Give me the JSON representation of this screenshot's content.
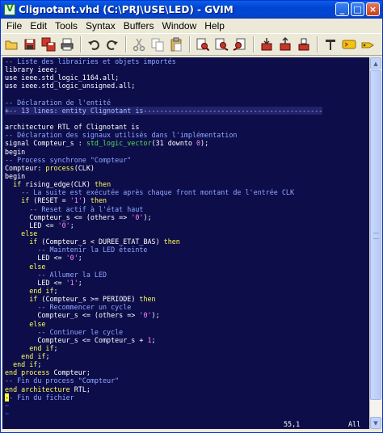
{
  "window": {
    "title": "Clignotant.vhd (C:\\PRJ\\USE\\LED) - GVIM",
    "minimize_glyph": "_",
    "maximize_glyph": "□",
    "close_glyph": "×"
  },
  "menu": [
    "File",
    "Edit",
    "Tools",
    "Syntax",
    "Buffers",
    "Window",
    "Help"
  ],
  "toolbar": [
    {
      "icon": "open-icon"
    },
    {
      "icon": "save-icon"
    },
    {
      "icon": "save-all-icon"
    },
    {
      "icon": "print-icon"
    },
    {
      "sep": true
    },
    {
      "icon": "undo-icon"
    },
    {
      "icon": "redo-icon"
    },
    {
      "sep": true
    },
    {
      "icon": "cut-icon"
    },
    {
      "icon": "copy-icon"
    },
    {
      "icon": "paste-icon"
    },
    {
      "sep": true
    },
    {
      "icon": "find-replace-icon"
    },
    {
      "icon": "find-next-icon"
    },
    {
      "icon": "find-prev-icon"
    },
    {
      "sep": true
    },
    {
      "icon": "load-session-icon"
    },
    {
      "icon": "save-session-icon"
    },
    {
      "icon": "run-script-icon"
    },
    {
      "sep": true
    },
    {
      "icon": "make-icon"
    },
    {
      "icon": "shell-icon"
    },
    {
      "icon": "tags-jump-icon"
    }
  ],
  "code_lines": [
    [
      [
        "-- Liste des librairies et objets importés",
        "comment"
      ]
    ],
    [
      [
        "library ieee;",
        "norm"
      ]
    ],
    [
      [
        "use ieee.std_logic_1164.all;",
        "norm"
      ]
    ],
    [
      [
        "use ieee.std_logic_unsigned.all;",
        "norm"
      ]
    ],
    [
      [
        "",
        "norm"
      ]
    ],
    [
      [
        "-- Déclaration de l'entité",
        "comment"
      ]
    ],
    [
      [
        "+-- 13 lines: entity Clignotant is--------------------------------------------",
        "fold"
      ]
    ],
    [
      [
        "",
        "norm"
      ]
    ],
    [
      [
        "architecture RTL of Clignotant is",
        "norm"
      ]
    ],
    [
      [
        "-- Déclaration des signaux utilisés dans l'implémentation",
        "comment"
      ]
    ],
    [
      [
        "signal Compteur_s : ",
        "norm"
      ],
      [
        "std_logic_vector",
        "type"
      ],
      [
        "(31 downto ",
        "norm"
      ],
      [
        "0",
        "str"
      ],
      [
        ");",
        "norm"
      ]
    ],
    [
      [
        "begin",
        "norm"
      ]
    ],
    [
      [
        "-- Process synchrone \"Compteur\"",
        "comment"
      ]
    ],
    [
      [
        "Compteur: ",
        "norm"
      ],
      [
        "process",
        "kw"
      ],
      [
        "(CLK)",
        "norm"
      ]
    ],
    [
      [
        "begin",
        "norm"
      ]
    ],
    [
      [
        "  ",
        "norm"
      ],
      [
        "if",
        "kw"
      ],
      [
        " rising_edge(CLK) ",
        "norm"
      ],
      [
        "then",
        "kw"
      ]
    ],
    [
      [
        "    -- La suite est exécutée après chaque front montant de l'entrée CLK",
        "comment"
      ]
    ],
    [
      [
        "    ",
        "norm"
      ],
      [
        "if",
        "kw"
      ],
      [
        " (RESET = ",
        "norm"
      ],
      [
        "'1'",
        "str"
      ],
      [
        ") ",
        "norm"
      ],
      [
        "then",
        "kw"
      ]
    ],
    [
      [
        "      -- Reset actif à l'état haut",
        "comment"
      ]
    ],
    [
      [
        "      Compteur_s <= (others => ",
        "norm"
      ],
      [
        "'0'",
        "str"
      ],
      [
        ");",
        "norm"
      ]
    ],
    [
      [
        "      LED <= ",
        "norm"
      ],
      [
        "'0'",
        "str"
      ],
      [
        ";",
        "norm"
      ]
    ],
    [
      [
        "    ",
        "norm"
      ],
      [
        "else",
        "kw"
      ]
    ],
    [
      [
        "      ",
        "norm"
      ],
      [
        "if",
        "kw"
      ],
      [
        " (Compteur_s < DUREE_ETAT_BAS) ",
        "norm"
      ],
      [
        "then",
        "kw"
      ]
    ],
    [
      [
        "        -- Maintenir la LED éteinte",
        "comment"
      ]
    ],
    [
      [
        "        LED <= ",
        "norm"
      ],
      [
        "'0'",
        "str"
      ],
      [
        ";",
        "norm"
      ]
    ],
    [
      [
        "      ",
        "norm"
      ],
      [
        "else",
        "kw"
      ]
    ],
    [
      [
        "        -- Allumer la LED",
        "comment"
      ]
    ],
    [
      [
        "        LED <= ",
        "norm"
      ],
      [
        "'1'",
        "str"
      ],
      [
        ";",
        "norm"
      ]
    ],
    [
      [
        "      ",
        "norm"
      ],
      [
        "end if",
        "kw"
      ],
      [
        ";",
        "norm"
      ]
    ],
    [
      [
        "      ",
        "norm"
      ],
      [
        "if",
        "kw"
      ],
      [
        " (Compteur_s >= PERIODE) ",
        "norm"
      ],
      [
        "then",
        "kw"
      ]
    ],
    [
      [
        "        -- Recommencer un cycle",
        "comment"
      ]
    ],
    [
      [
        "        Compteur_s <= (others => ",
        "norm"
      ],
      [
        "'0'",
        "str"
      ],
      [
        ");",
        "norm"
      ]
    ],
    [
      [
        "      ",
        "norm"
      ],
      [
        "else",
        "kw"
      ]
    ],
    [
      [
        "        -- Continuer le cycle",
        "comment"
      ]
    ],
    [
      [
        "        Compteur_s <= Compteur_s + ",
        "norm"
      ],
      [
        "1",
        "str"
      ],
      [
        ";",
        "norm"
      ]
    ],
    [
      [
        "      ",
        "norm"
      ],
      [
        "end if",
        "kw"
      ],
      [
        ";",
        "norm"
      ]
    ],
    [
      [
        "    ",
        "norm"
      ],
      [
        "end if",
        "kw"
      ],
      [
        ";",
        "norm"
      ]
    ],
    [
      [
        "  ",
        "norm"
      ],
      [
        "end if",
        "kw"
      ],
      [
        ";",
        "norm"
      ]
    ],
    [
      [
        "end process",
        "kw"
      ],
      [
        " Compteur;",
        "norm"
      ]
    ],
    [
      [
        "-- Fin du process \"Compteur\"",
        "comment"
      ]
    ],
    [
      [
        "end architecture",
        "kw"
      ],
      [
        " RTL;",
        "norm"
      ]
    ],
    [
      [
        "-",
        "cursor"
      ],
      [
        "- Fin du fichier",
        "comment"
      ]
    ]
  ],
  "filler_lines": 5,
  "filler_glyph": "~",
  "status": {
    "position": "55,1",
    "percent": "All"
  },
  "colors": {
    "background": "#0d0d4a",
    "comment": "#8fa8ff",
    "keyword": "#ffff55",
    "string": "#ff8aff",
    "type": "#50e050"
  }
}
